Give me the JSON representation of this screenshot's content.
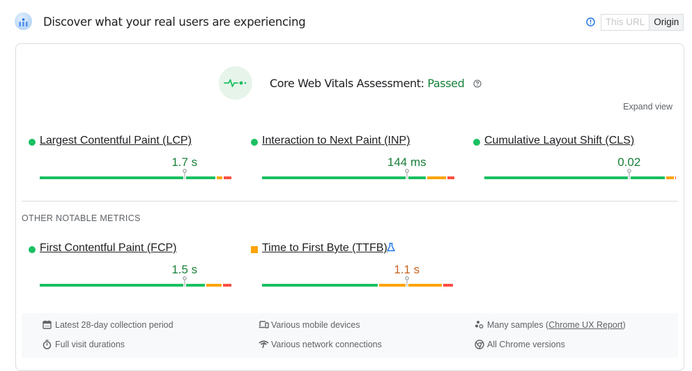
{
  "header": {
    "title": "Discover what your real users are experiencing",
    "logo_icon": "crux-logo-icon",
    "info_icon": "info-icon",
    "toggle": {
      "options": [
        {
          "label": "This URL",
          "active": false
        },
        {
          "label": "Origin",
          "active": true
        }
      ]
    }
  },
  "assessment": {
    "icon": "heartbeat-icon",
    "label": "Core Web Vitals Assessment:",
    "status": "Passed",
    "help_icon": "help-icon",
    "expand_label": "Expand view"
  },
  "colors": {
    "good": "#1ac061",
    "needs_improvement": "#ffa400",
    "poor": "#ff4e42",
    "good_text": "#188038",
    "needs_improvement_text": "#c5631e"
  },
  "core_metrics": [
    {
      "name": "Largest Contentful Paint (LCP)",
      "value": "1.7 s",
      "rating": "good",
      "distribution": {
        "good": 0.917,
        "needs_improvement": 0.036,
        "poor": 0.039
      },
      "marker_percentile": 0.75
    },
    {
      "name": "Interaction to Next Paint (INP)",
      "value": "144 ms",
      "rating": "good",
      "distribution": {
        "good": 0.855,
        "needs_improvement": 0.104,
        "poor": 0.036
      },
      "marker_percentile": 0.75
    },
    {
      "name": "Cumulative Layout Shift (CLS)",
      "value": "0.02",
      "rating": "good",
      "distribution": {
        "good": 0.942,
        "needs_improvement": 0.046,
        "poor": 0.006
      },
      "marker_percentile": 0.75
    }
  ],
  "other_section_label": "OTHER NOTABLE METRICS",
  "other_metrics": [
    {
      "name": "First Contentful Paint (FCP)",
      "value": "1.5 s",
      "rating": "good",
      "distribution": {
        "good": 0.862,
        "needs_improvement": 0.087,
        "poor": 0.045
      },
      "marker_percentile": 0.75
    },
    {
      "name": "Time to First Byte (TTFB)",
      "value": "1.1 s",
      "rating": "needs_improvement",
      "experimental_icon": "flask-icon",
      "distribution": {
        "good": 0.607,
        "needs_improvement": 0.332,
        "poor": 0.052
      },
      "marker_percentile": 0.75
    }
  ],
  "footer": {
    "items": [
      {
        "icon": "calendar-icon",
        "text": "Latest 28-day collection period"
      },
      {
        "icon": "devices-icon",
        "text": "Various mobile devices"
      },
      {
        "icon": "samples-icon",
        "text_before": "Many samples (",
        "link": "Chrome UX Report",
        "text_after": ")"
      },
      {
        "icon": "stopwatch-icon",
        "text": "Full visit durations"
      },
      {
        "icon": "network-icon",
        "text": "Various network connections"
      },
      {
        "icon": "chrome-icon",
        "text": "All Chrome versions"
      }
    ]
  }
}
